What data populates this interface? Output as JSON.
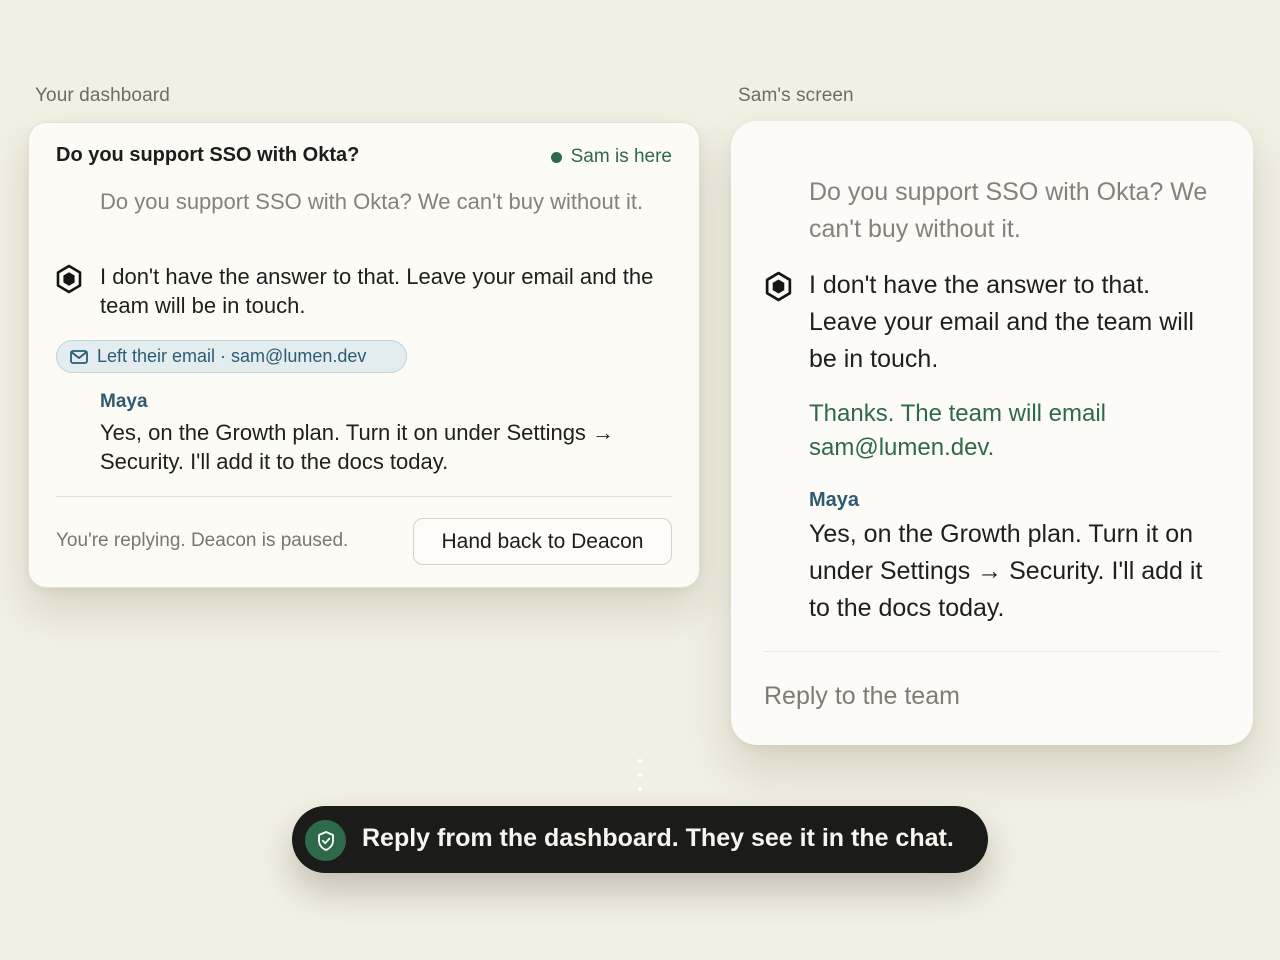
{
  "dashboard": {
    "label": "Your dashboard",
    "title": "Do you support SSO with Okta?",
    "presence": "Sam is here",
    "customer_message": "Do you support SSO with Okta? We can't buy without it.",
    "bot_message": "I don't have the answer to that. Leave your email and the team will be in touch.",
    "email_chip": "Left their email · sam@lumen.dev",
    "agent_name": "Maya",
    "agent_message": "Yes, on the Growth plan. Turn it on under Settings → Security. I'll add it to the docs today.",
    "status": "You're replying. Deacon is paused.",
    "handback_button": "Hand back to Deacon"
  },
  "customer_screen": {
    "label": "Sam's screen",
    "customer_message": "Do you support SSO with Okta? We can't buy without it.",
    "bot_message": "I don't have the answer to that. Leave your email and the team will be in touch.",
    "confirmation": "Thanks. The team will email sam@lumen.dev.",
    "agent_name": "Maya",
    "agent_message": "Yes, on the Growth plan. Turn it on under Settings → Security. I'll add it to the docs today.",
    "reply_placeholder": "Reply to the team"
  },
  "banner": {
    "text": "Reply from the dashboard. They see it in the chat.",
    "icon": "shield-check-icon"
  },
  "icons": {
    "bot": "hexagon-bot-icon",
    "email": "mail-icon",
    "presence": "online-dot"
  },
  "colors": {
    "background": "#f2efe3",
    "accent_green": "#2e6a49",
    "agent_blue": "#2f5b72",
    "chip_bg": "#e3ecef",
    "banner_bg": "#1b1b19"
  }
}
